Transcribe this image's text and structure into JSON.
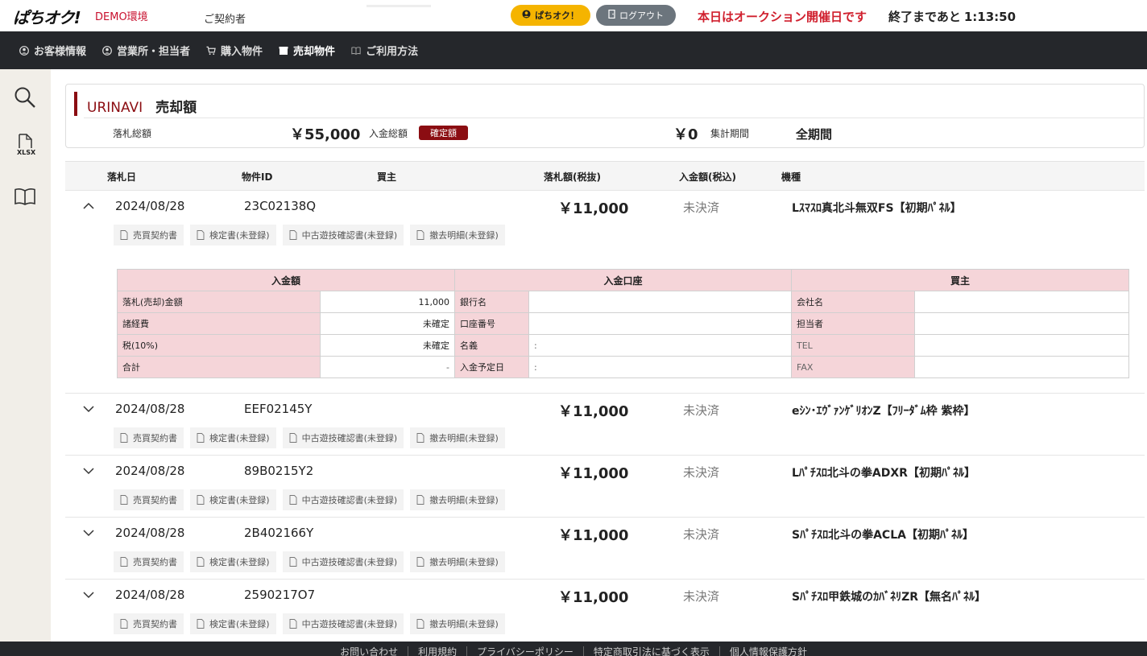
{
  "header": {
    "logo": "ぱちオク!",
    "env": "DEMO環境",
    "contract_label": "ご契約者",
    "pachi_button": "ぱちオク！",
    "logout_button": "ログアウト",
    "auction_message": "本日はオークション開催日です",
    "remaining_label": "終了まであと",
    "remaining_time": "1:13:50"
  },
  "nav": {
    "items": [
      {
        "label": "お客様情報"
      },
      {
        "label": "営業所・担当者"
      },
      {
        "label": "購入物件"
      },
      {
        "label": "売却物件"
      },
      {
        "label": "ご利用方法"
      }
    ]
  },
  "sidebar": {
    "xlsx_label": "XLSX"
  },
  "summary": {
    "brand": "URINAVI",
    "title": "売却額",
    "bid_total_label": "落札総額",
    "bid_total_value": "￥55,000",
    "payment_total_label": "入金総額",
    "confirmed_badge": "確定額",
    "payment_total_value": "￥0",
    "period_label": "集計期間",
    "period_value": "全期間"
  },
  "table": {
    "headers": [
      "落札日",
      "物件ID",
      "買主",
      "落札額(税抜)",
      "入金額(税込)",
      "機種"
    ],
    "doc_buttons": [
      "売買契約書",
      "検定書(未登録)",
      "中古遊技確認書(未登録)",
      "撤去明細(未登録)"
    ],
    "rows": [
      {
        "date": "2024/08/28",
        "id": "23C02138Q",
        "amount": "￥11,000",
        "status": "未決済",
        "model": "Lｽﾏｽﾛ真北斗無双FS【初期ﾊﾟﾈﾙ】"
      },
      {
        "date": "2024/08/28",
        "id": "EEF02145Y",
        "amount": "￥11,000",
        "status": "未決済",
        "model": "eｼﾝ･ｴｳﾞｧﾝｹﾞﾘｵﾝZ【ﾌﾘｰﾀﾞﾑ枠 紫枠】"
      },
      {
        "date": "2024/08/28",
        "id": "89B0215Y2",
        "amount": "￥11,000",
        "status": "未決済",
        "model": "Lﾊﾟﾁｽﾛ北斗の拳ADXR【初期ﾊﾟﾈﾙ】"
      },
      {
        "date": "2024/08/28",
        "id": "2B402166Y",
        "amount": "￥11,000",
        "status": "未決済",
        "model": "Sﾊﾟﾁｽﾛ北斗の拳ACLA【初期ﾊﾟﾈﾙ】"
      },
      {
        "date": "2024/08/28",
        "id": "2590217O7",
        "amount": "￥11,000",
        "status": "未決済",
        "model": "Sﾊﾟﾁｽﾛ甲鉄城のｶﾊﾞﾈﾘZR【無名ﾊﾟﾈﾙ】"
      }
    ]
  },
  "detail": {
    "h_payment": "入金額",
    "h_account": "入金口座",
    "h_buyer": "買主",
    "rows": [
      {
        "l1": "落札(売却)金額",
        "v1": "11,000",
        "l2": "銀行名",
        "v2": "",
        "l3": "会社名",
        "v3": ""
      },
      {
        "l1": "諸経費",
        "v1": "未確定",
        "l2": "口座番号",
        "v2": "",
        "l3": "担当者",
        "v3": ""
      },
      {
        "l1": "税(10%)",
        "v1": "未確定",
        "l2": "名義",
        "v2": ":",
        "l3": "TEL",
        "v3": ""
      },
      {
        "l1": "合計",
        "v1": "-",
        "l2": "入金予定日",
        "v2": ":",
        "l3": "FAX",
        "v3": ""
      }
    ]
  },
  "footer": {
    "links": [
      "お問い合わせ",
      "利用規約",
      "プライバシーポリシー",
      "特定商取引法に基づく表示",
      "個人情報保護方針"
    ]
  }
}
